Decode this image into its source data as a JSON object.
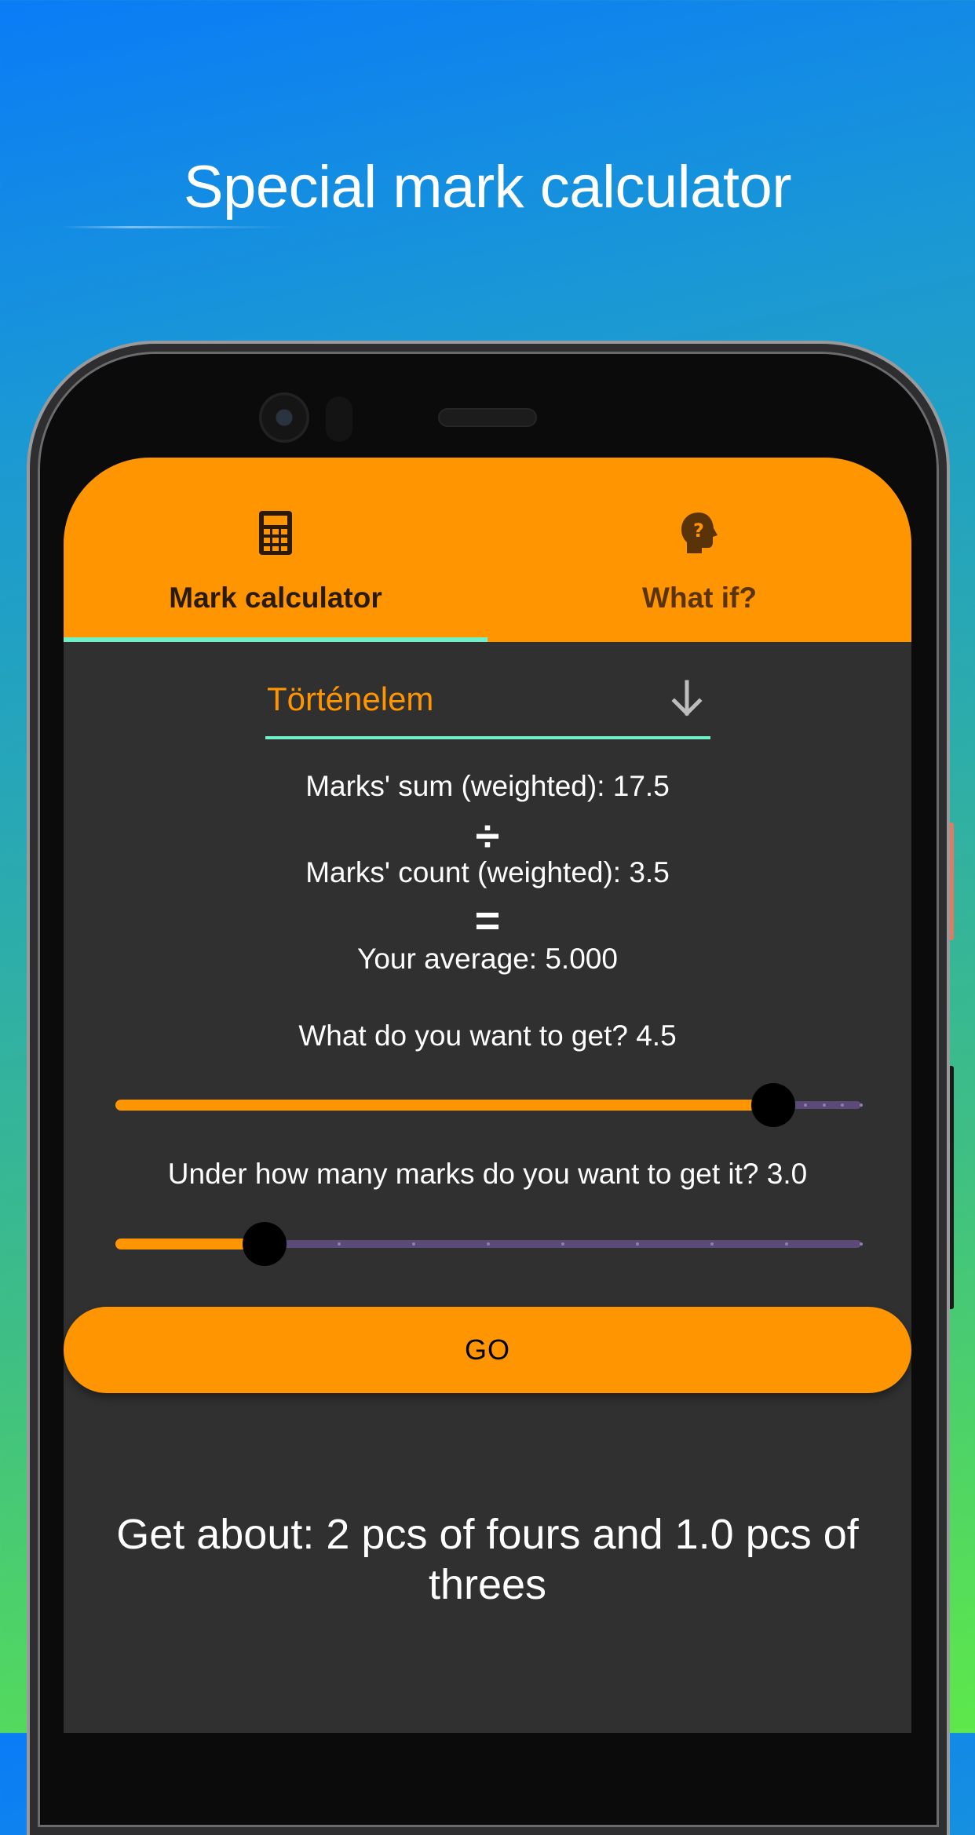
{
  "headline": "Special mark calculator",
  "tabs": [
    {
      "label": "Mark calculator",
      "icon": "calculator-icon",
      "active": true
    },
    {
      "label": "What if?",
      "icon": "head-question-icon",
      "active": false
    }
  ],
  "subject": {
    "value": "Történelem",
    "icon": "arrow-down-icon"
  },
  "stats": {
    "sum": "Marks' sum (weighted): 17.5",
    "divide_symbol": "÷",
    "count": "Marks' count (weighted): 3.5",
    "equals_symbol": "=",
    "average": "Your average: 5.000"
  },
  "target": {
    "label": "What do you want to get? 4.5",
    "value": 4.5,
    "min": 1,
    "max": 5,
    "fraction": 0.882
  },
  "marks": {
    "label": "Under how many marks do you want to get it? 3.0",
    "value": 3.0,
    "min": 1,
    "max": 10,
    "fraction": 0.2
  },
  "go_label": "GO",
  "result": "Get about: 2 pcs of fours and 1.0 pcs of threes",
  "colors": {
    "accent": "#ff9500",
    "indicator": "#6ff0c9",
    "surface": "#303030",
    "track_inactive": "#5b4a78"
  }
}
